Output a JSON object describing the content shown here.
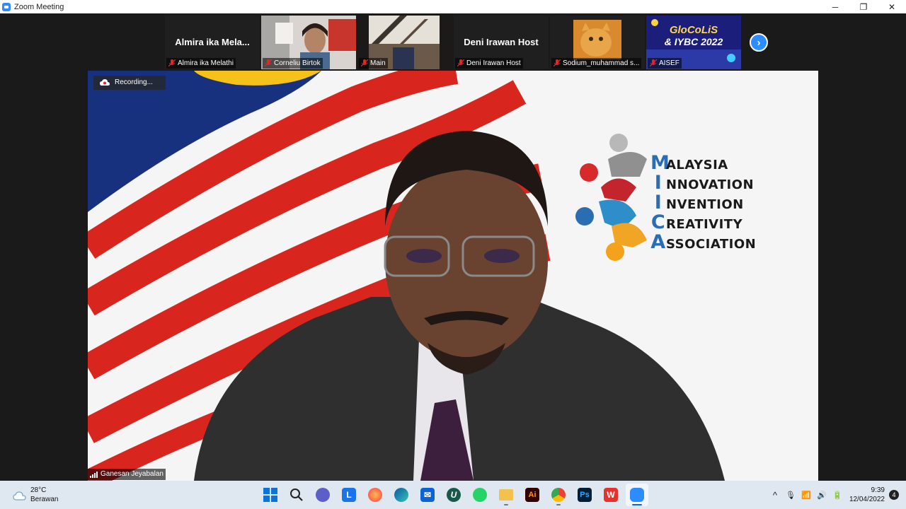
{
  "window": {
    "title": "Zoom Meeting",
    "controls": {
      "minimize": "─",
      "maximize": "❐",
      "close": "✕"
    }
  },
  "thumbnails": [
    {
      "label": "Almira ika Melathi",
      "big_name": "Almira  ika  Mela...",
      "type": "name"
    },
    {
      "label": "Corneliu Birtok",
      "type": "video"
    },
    {
      "label": "Main",
      "type": "video"
    },
    {
      "label": "Deni Irawan Host",
      "big_name": "Deni Irawan Host",
      "type": "name"
    },
    {
      "label": "Sodium_muhammad s...",
      "type": "video"
    },
    {
      "label": "AISEF",
      "type": "video",
      "banner_line1": "GloCoLiS",
      "banner_line2": "& IYBC 2022"
    }
  ],
  "next_button": "›",
  "main_video": {
    "recording_text": "Recording...",
    "speaker_name": "Ganesan Jeyabalan",
    "mica": [
      {
        "cap": "M",
        "rest": "ALAYSIA"
      },
      {
        "cap": "I",
        "rest": "NNOVATION"
      },
      {
        "cap": "I",
        "rest": "NVENTION"
      },
      {
        "cap": "C",
        "rest": "REATIVITY"
      },
      {
        "cap": "A",
        "rest": "SSOCIATION"
      }
    ]
  },
  "taskbar": {
    "weather_temp": "28°C",
    "weather_desc": "Berawan",
    "time": "9:39",
    "date": "12/04/2022",
    "notification_count": "4",
    "tray": {
      "chevron": "^",
      "mic": "🎙",
      "wifi": "📶",
      "volume": "🔊",
      "battery": "🔋"
    },
    "apps": [
      {
        "name": "windows-start",
        "color": "#0a74da",
        "glyph": ""
      },
      {
        "name": "search",
        "color": "transparent",
        "glyph": ""
      },
      {
        "name": "teams-chat",
        "color": "#5b5fc7",
        "glyph": ""
      },
      {
        "name": "app-l",
        "color": "#1a73e8",
        "glyph": "L"
      },
      {
        "name": "firefox",
        "color": "#ff7139",
        "glyph": ""
      },
      {
        "name": "edge",
        "color": "#0f8bd6",
        "glyph": ""
      },
      {
        "name": "mail",
        "color": "#0a64d6",
        "glyph": "✉"
      },
      {
        "name": "app-u",
        "color": "#18594b",
        "glyph": "U"
      },
      {
        "name": "whatsapp",
        "color": "#25d366",
        "glyph": ""
      },
      {
        "name": "file-explorer",
        "color": "#f2c14e",
        "glyph": ""
      },
      {
        "name": "illustrator",
        "color": "#330000",
        "glyph": "Ai"
      },
      {
        "name": "chrome",
        "color": "#34a853",
        "glyph": ""
      },
      {
        "name": "photoshop",
        "color": "#001e36",
        "glyph": "Ps"
      },
      {
        "name": "wps",
        "color": "#e5322d",
        "glyph": "W"
      },
      {
        "name": "zoom",
        "color": "#2d8cff",
        "glyph": ""
      }
    ]
  }
}
